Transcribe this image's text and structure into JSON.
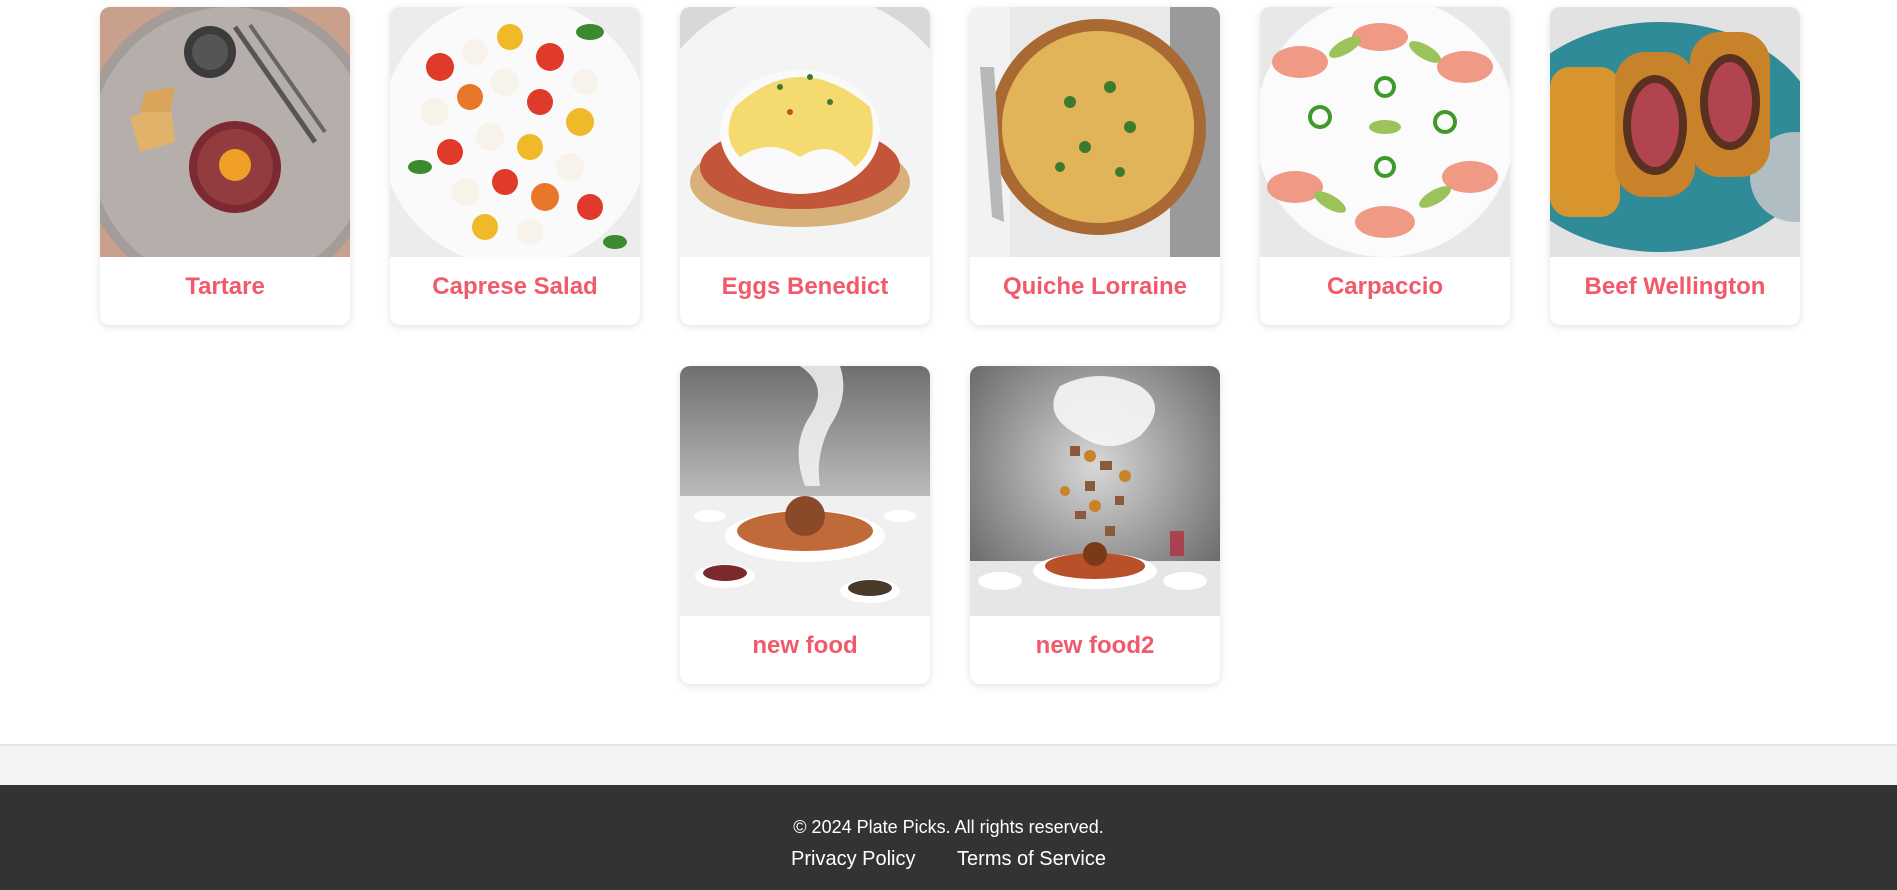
{
  "cards": [
    {
      "title": "Tartare",
      "image": "tartare-dish-photo"
    },
    {
      "title": "Caprese Salad",
      "image": "caprese-salad-photo"
    },
    {
      "title": "Eggs Benedict",
      "image": "eggs-benedict-photo"
    },
    {
      "title": "Quiche Lorraine",
      "image": "quiche-lorraine-photo"
    },
    {
      "title": "Carpaccio",
      "image": "carpaccio-photo"
    },
    {
      "title": "Beef Wellington",
      "image": "beef-wellington-photo"
    },
    {
      "title": "new food",
      "image": "smoky-feast-table-photo"
    },
    {
      "title": "new food2",
      "image": "floating-ingredients-smoke-photo"
    }
  ],
  "footer": {
    "copyright": "© 2024 Plate Picks. All rights reserved.",
    "links": [
      {
        "label": "Privacy Policy"
      },
      {
        "label": "Terms of Service"
      }
    ]
  },
  "colors": {
    "title_accent": "#f05a6a",
    "footer_bg": "#333333",
    "prefooter_bg": "#f4f4f4"
  }
}
